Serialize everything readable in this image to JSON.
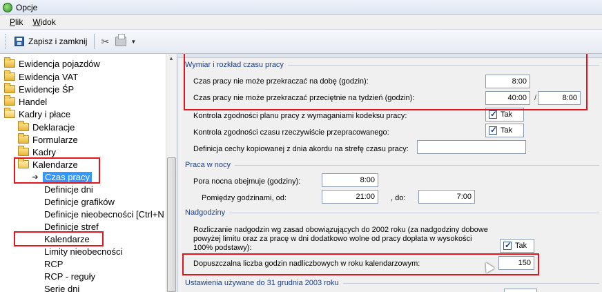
{
  "window": {
    "title": "Opcje"
  },
  "menu": [
    {
      "label": "Plik",
      "accel": "P"
    },
    {
      "label": "Widok",
      "accel": "W"
    }
  ],
  "toolbar": {
    "save_label": "Zapisz i zamknij"
  },
  "tree": [
    {
      "label": "Ewidencja pojazdów",
      "icon": "folder"
    },
    {
      "label": "Ewidencja VAT",
      "icon": "folder"
    },
    {
      "label": "Ewidencje ŚP",
      "icon": "folder"
    },
    {
      "label": "Handel",
      "icon": "folder"
    },
    {
      "label": "Kadry i płace",
      "icon": "folder-open"
    },
    {
      "label": "Deklaracje",
      "icon": "folder"
    },
    {
      "label": "Formularze",
      "icon": "folder"
    },
    {
      "label": "Kadry",
      "icon": "folder"
    },
    {
      "label": "Kalendarze",
      "icon": "folder-open"
    },
    {
      "label": "Czas pracy",
      "icon": "pointer",
      "selected": true
    },
    {
      "label": "Definicje dni"
    },
    {
      "label": "Definicje grafików"
    },
    {
      "label": "Definicje nieobecności [Ctrl+N"
    },
    {
      "label": "Definicje stref"
    },
    {
      "label": "Kalendarze"
    },
    {
      "label": "Limity nieobecności"
    },
    {
      "label": "RCP"
    },
    {
      "label": "RCP - reguły"
    },
    {
      "label": "Serie dni"
    }
  ],
  "sections": {
    "wymiar": {
      "title": "Wymiar i rozkład czasu pracy",
      "doba_label": "Czas pracy nie może przekraczać na dobę (godzin):",
      "doba_value": "8:00",
      "tydzien_label": "Czas pracy nie może przekraczać przeciętnie na tydzień (godzin):",
      "tydzien_value1": "40:00",
      "tydzien_sep": "/",
      "tydzien_value2": "8:00",
      "kontrola_label": "Kontrola zgodności planu pracy z wymaganiami kodeksu pracy:",
      "kontrola_value": "Tak",
      "kontrola2_label": "Kontrola zgodności czasu rzeczywiście przepracowanego:",
      "kontrola2_value": "Tak",
      "cecha_label": "Definicja cechy kopiowanej z dnia akordu na strefę czasu pracy:",
      "cecha_value": ""
    },
    "noc": {
      "title": "Praca w nocy",
      "pora_label": "Pora nocna obejmuje (godziny):",
      "pora_value": "8:00",
      "pomiedzy_label": "Pomiędzy godzinami, od:",
      "od_value": "21:00",
      "do_label": ", do:",
      "do_value": "7:00"
    },
    "nadgodziny": {
      "title": "Nadgodziny",
      "rozliczanie_label_1": "Rozliczanie nadgodzin wg zasad obowiązujących do 2002 roku (za nadgodziny dobowe",
      "rozliczanie_label_2": "powyżej limitu oraz za pracę w dni dodatkowo wolne od pracy dopłata w wysokości",
      "rozliczanie_label_3": "100% podstawy):",
      "rozliczanie_value": "Tak",
      "dopuszczalna_label": "Dopuszczalna liczba godzin nadliczbowych w roku kalendarzowym:",
      "dopuszczalna_value": "150"
    },
    "ustawienia": {
      "title": "Ustawienia używane do 31 grudnia 2003 roku"
    }
  }
}
